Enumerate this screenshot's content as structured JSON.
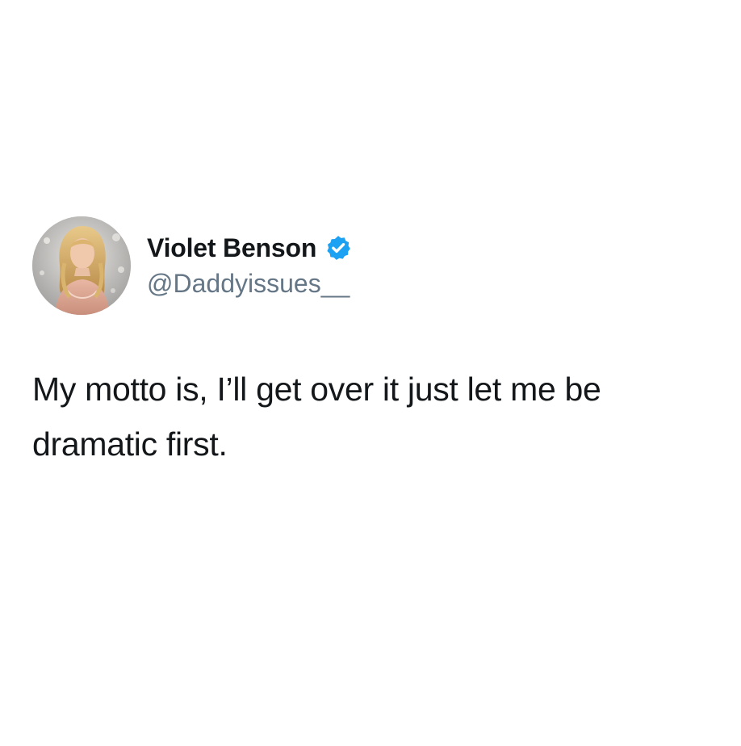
{
  "tweet": {
    "author": {
      "display_name": "Violet Benson",
      "handle": "@Daddyissues__",
      "verified": true
    },
    "text": "My motto is, I’ll get over it just let me be dramatic first."
  },
  "colors": {
    "name": "#14171a",
    "handle": "#657786",
    "verified_badge": "#1da1f2",
    "background": "#ffffff"
  },
  "icons": {
    "verified": "verified-badge-icon",
    "avatar": "profile-photo"
  }
}
